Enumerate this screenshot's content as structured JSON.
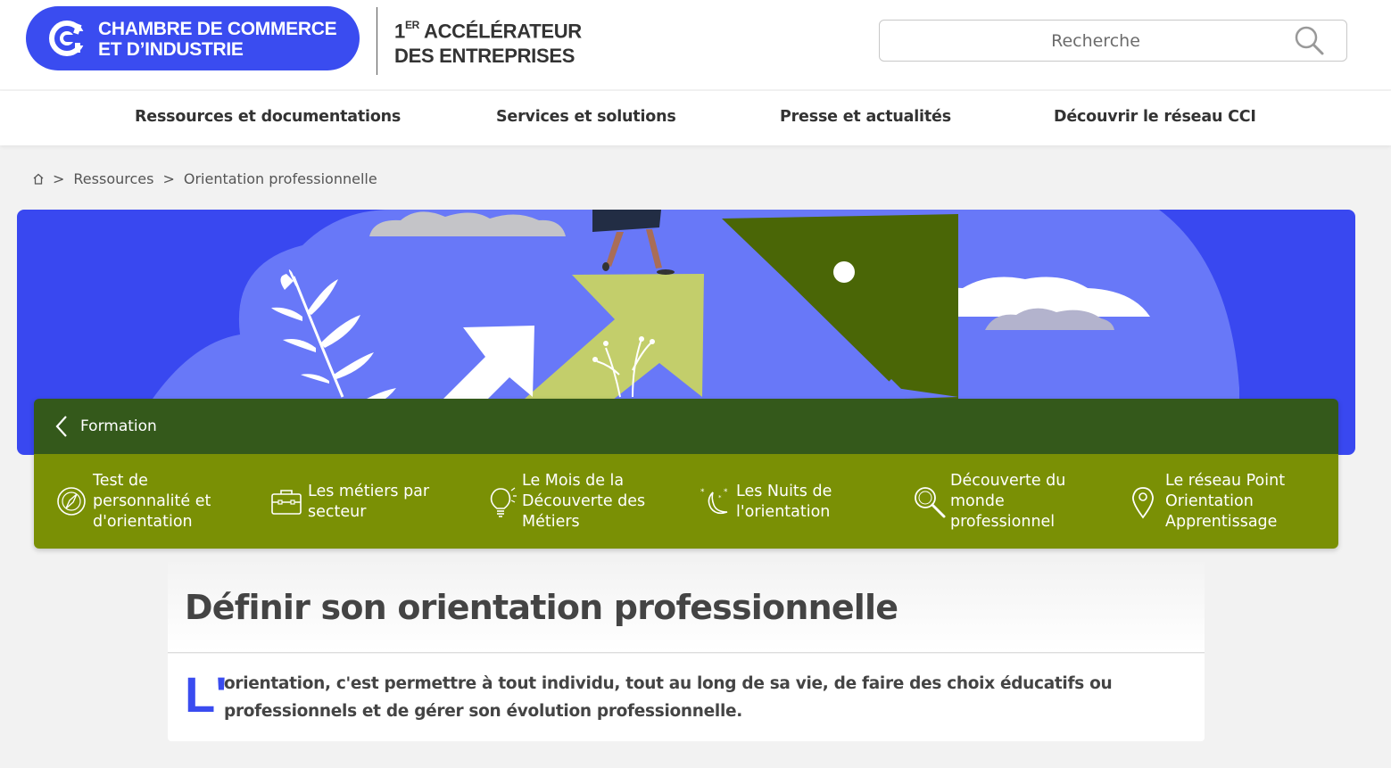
{
  "header": {
    "logo_line1": "CHAMBRE DE COMMERCE",
    "logo_line2": "ET D’INDUSTRIE",
    "tagline_prefix": "1",
    "tagline_sup": "ER",
    "tagline_line1_rest": " ACCÉLÉRATEUR",
    "tagline_line2": "DES ENTREPRISES",
    "search_placeholder": "Recherche",
    "brand_color": "#3a4cf0"
  },
  "nav": {
    "items": [
      "Ressources et documentations",
      "Services et solutions",
      "Presse et actualités",
      "Découvrir le réseau CCI"
    ]
  },
  "breadcrumb": {
    "home_icon": "home-icon",
    "sep": ">",
    "items": [
      "Ressources",
      "Orientation professionnelle"
    ]
  },
  "subnav": {
    "title": "Formation",
    "header_color": "#34591b",
    "body_color": "#7a9005",
    "items": [
      {
        "label": "Test de\npersonnalité et\nd'orientation",
        "icon": "compass-icon"
      },
      {
        "label": "Les métiers par\nsecteur",
        "icon": "briefcase-icon"
      },
      {
        "label": "Le Mois de la\nDécouverte des\nMétiers",
        "icon": "lightbulb-icon"
      },
      {
        "label": "Les Nuits de\nl'orientation",
        "icon": "moon-stars-icon"
      },
      {
        "label": "Découverte du\nmonde\nprofessionnel",
        "icon": "magnifier-icon"
      },
      {
        "label": "Le réseau Point\nOrientation\nApprentissage",
        "icon": "location-pin-icon"
      }
    ]
  },
  "content": {
    "title": "Définir son orientation professionnelle",
    "dropcap": "L'",
    "intro": "orientation, c'est permettre à tout individu, tout au long de sa vie, de faire des choix éducatifs ou professionnels et de gérer son évolution professionnelle."
  }
}
